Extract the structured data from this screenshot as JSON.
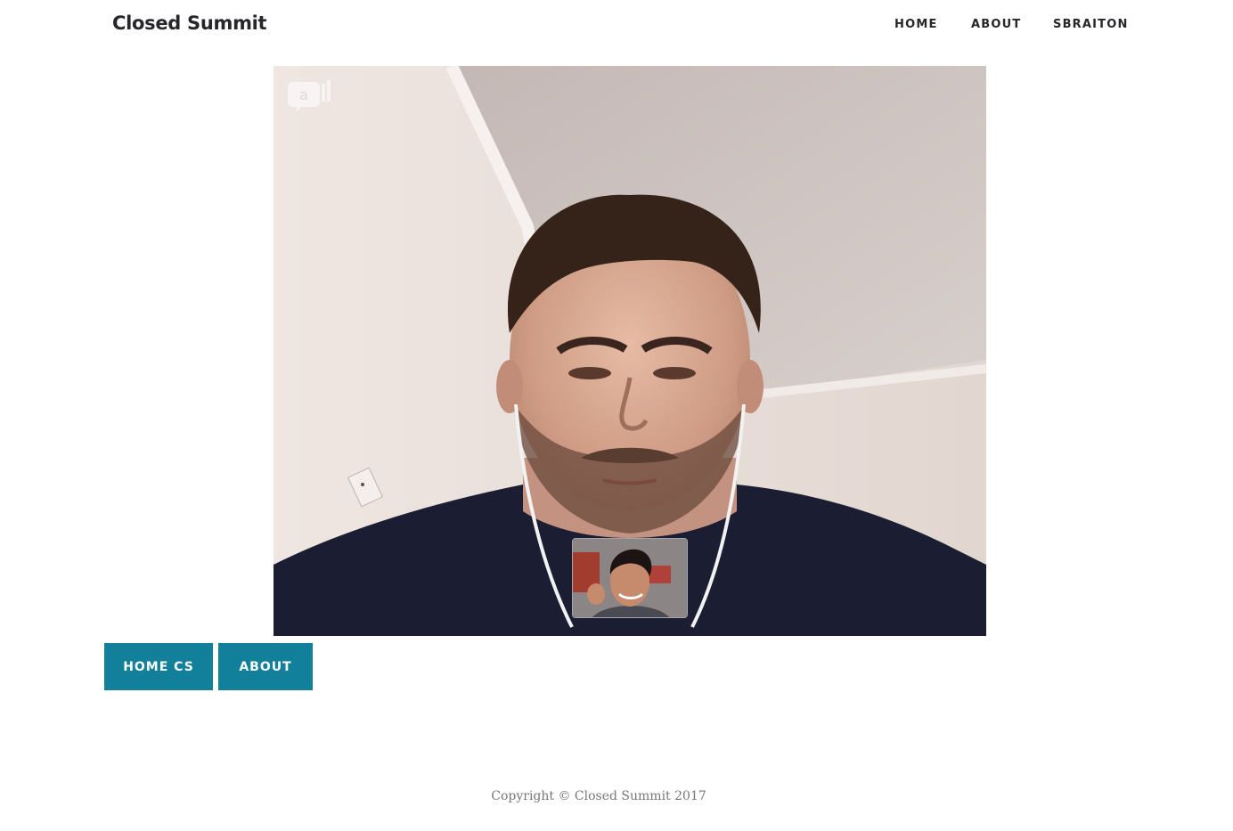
{
  "header": {
    "brand": "Closed Summit",
    "nav": [
      {
        "label": "HOME"
      },
      {
        "label": "ABOUT"
      },
      {
        "label": "SBRAITON"
      }
    ]
  },
  "video": {
    "watermark_icon": "chat-video-icon",
    "pip_icon": "self-view-video"
  },
  "buttons": [
    {
      "label": "HOME CS"
    },
    {
      "label": "ABOUT"
    }
  ],
  "footer": {
    "copyright": "Copyright © Closed Summit 2017"
  },
  "colors": {
    "accent": "#12809a",
    "text": "#26262b",
    "footer_text": "#777777"
  }
}
